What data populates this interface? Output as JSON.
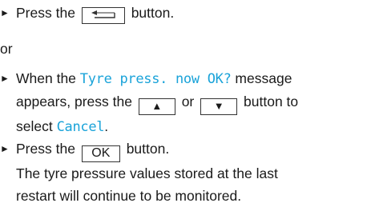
{
  "steps": [
    {
      "before": "Press the",
      "button_icon": "back-arrow-icon",
      "after": "button."
    },
    {
      "or": "or"
    },
    {
      "line1_a": "When the",
      "line1_msg": "Tyre press. now OK?",
      "line1_b": "message",
      "line2_a": "appears, press the",
      "up_glyph": "▲",
      "line2_or": "or",
      "down_glyph": "▼",
      "line2_b": "button to",
      "line3_a": "select",
      "line3_cancel": "Cancel",
      "line3_b": "."
    },
    {
      "before": "Press the",
      "button_label": "OK",
      "after": "button.",
      "result_line1": "The tyre pressure values stored at the last",
      "result_line2": "restart will continue to be monitored."
    }
  ],
  "bullet_glyph": "►",
  "colors": {
    "text": "#1a1a1a",
    "display_text": "#1aa3d9"
  }
}
